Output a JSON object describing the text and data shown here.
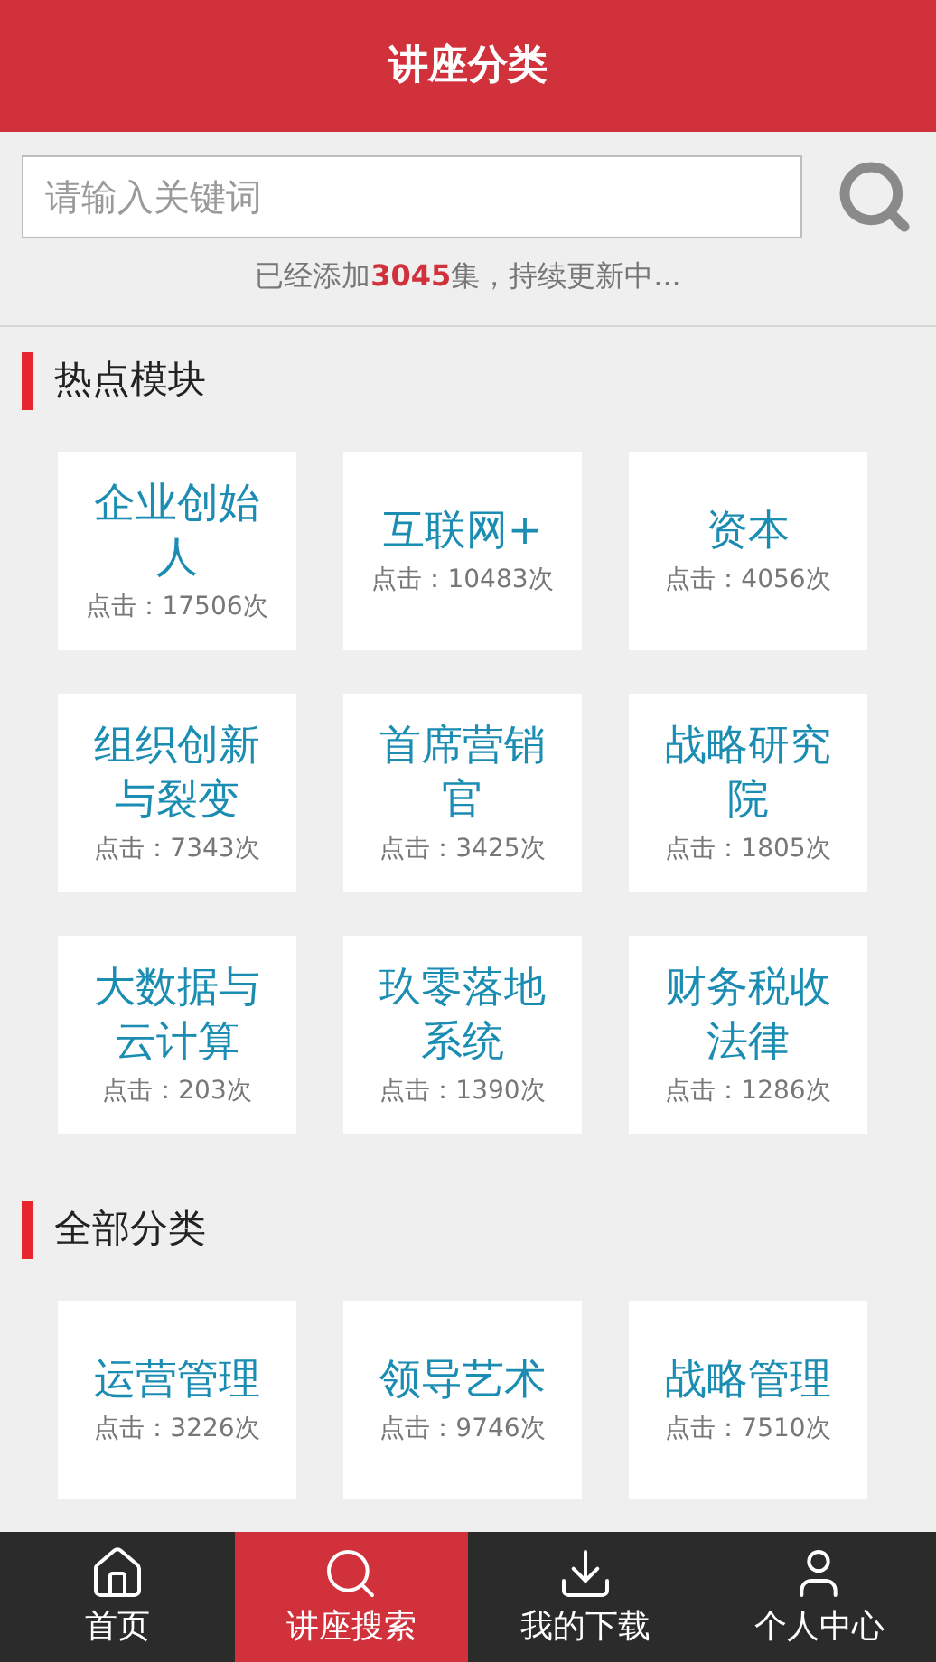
{
  "header": {
    "title": "讲座分类"
  },
  "search": {
    "placeholder": "请输入关键词"
  },
  "subtitle": {
    "prefix": "已经添加",
    "count": "3045",
    "suffix": "集，持续更新中..."
  },
  "sections": [
    {
      "title": "热点模块",
      "cards": [
        {
          "title": "企业创始人",
          "clicks": "点击：17506次"
        },
        {
          "title": "互联网+",
          "clicks": "点击：10483次"
        },
        {
          "title": "资本",
          "clicks": "点击：4056次"
        },
        {
          "title": "组织创新与裂变",
          "clicks": "点击：7343次"
        },
        {
          "title": "首席营销官",
          "clicks": "点击：3425次"
        },
        {
          "title": "战略研究院",
          "clicks": "点击：1805次"
        },
        {
          "title": "大数据与云计算",
          "clicks": "点击：203次"
        },
        {
          "title": "玖零落地系统",
          "clicks": "点击：1390次"
        },
        {
          "title": "财务税收法律",
          "clicks": "点击：1286次"
        }
      ]
    },
    {
      "title": "全部分类",
      "cards": [
        {
          "title": "运营管理",
          "clicks": "点击：3226次"
        },
        {
          "title": "领导艺术",
          "clicks": "点击：9746次"
        },
        {
          "title": "战略管理",
          "clicks": "点击：7510次"
        }
      ]
    }
  ],
  "nav": [
    {
      "kind": "home",
      "label": "首页",
      "selected": false
    },
    {
      "kind": "search",
      "label": "讲座搜索",
      "selected": true
    },
    {
      "kind": "download",
      "label": "我的下载",
      "selected": false
    },
    {
      "kind": "user",
      "label": "个人中心",
      "selected": false
    }
  ]
}
